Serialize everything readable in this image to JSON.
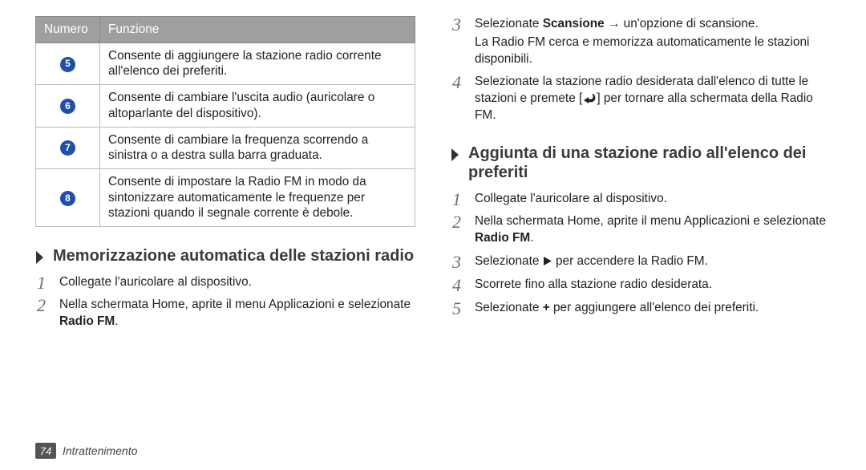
{
  "table": {
    "head": {
      "c1": "Numero",
      "c2": "Funzione"
    },
    "rows": [
      {
        "num": "5",
        "desc": "Consente di aggiungere la stazione radio corrente all'elenco dei preferiti."
      },
      {
        "num": "6",
        "desc": "Consente di cambiare l'uscita audio (auricolare o altoparlante del dispositivo)."
      },
      {
        "num": "7",
        "desc": "Consente di cambiare la frequenza scorrendo a sinistra o a destra sulla barra graduata."
      },
      {
        "num": "8",
        "desc": "Consente di impostare la Radio FM in modo da sintonizzare automaticamente le frequenze per stazioni quando il segnale corrente è debole."
      }
    ]
  },
  "left_section": {
    "title": "Memorizzazione automatica delle stazioni radio",
    "steps": {
      "s1": "Collegate l'auricolare al dispositivo.",
      "s2a": "Nella schermata Home, aprite il menu Applicazioni e selezionate ",
      "s2b": "Radio FM",
      "s2c": "."
    }
  },
  "right_top_steps": {
    "s3a": "Selezionate ",
    "s3b": "Scansione",
    "s3c": " → un'opzione di scansione.",
    "s3sub": "La Radio FM cerca e memorizza automaticamente le stazioni disponibili.",
    "s4a": "Selezionate la stazione radio desiderata dall'elenco di tutte le stazioni e premete [",
    "s4b": "] per tornare alla schermata della Radio FM."
  },
  "right_section": {
    "title": "Aggiunta di una stazione radio all'elenco dei preferiti",
    "steps": {
      "s1": "Collegate l'auricolare al dispositivo.",
      "s2a": "Nella schermata Home, aprite il menu Applicazioni e selezionate ",
      "s2b": "Radio FM",
      "s2c": ".",
      "s3a": "Selezionate ",
      "s3b": " per accendere la Radio FM.",
      "s4": "Scorrete fino alla stazione radio desiderata.",
      "s5a": "Selezionate ",
      "s5b": "+",
      "s5c": " per aggiungere all'elenco dei preferiti."
    }
  },
  "footer": {
    "page": "74",
    "section": "Intrattenimento"
  }
}
